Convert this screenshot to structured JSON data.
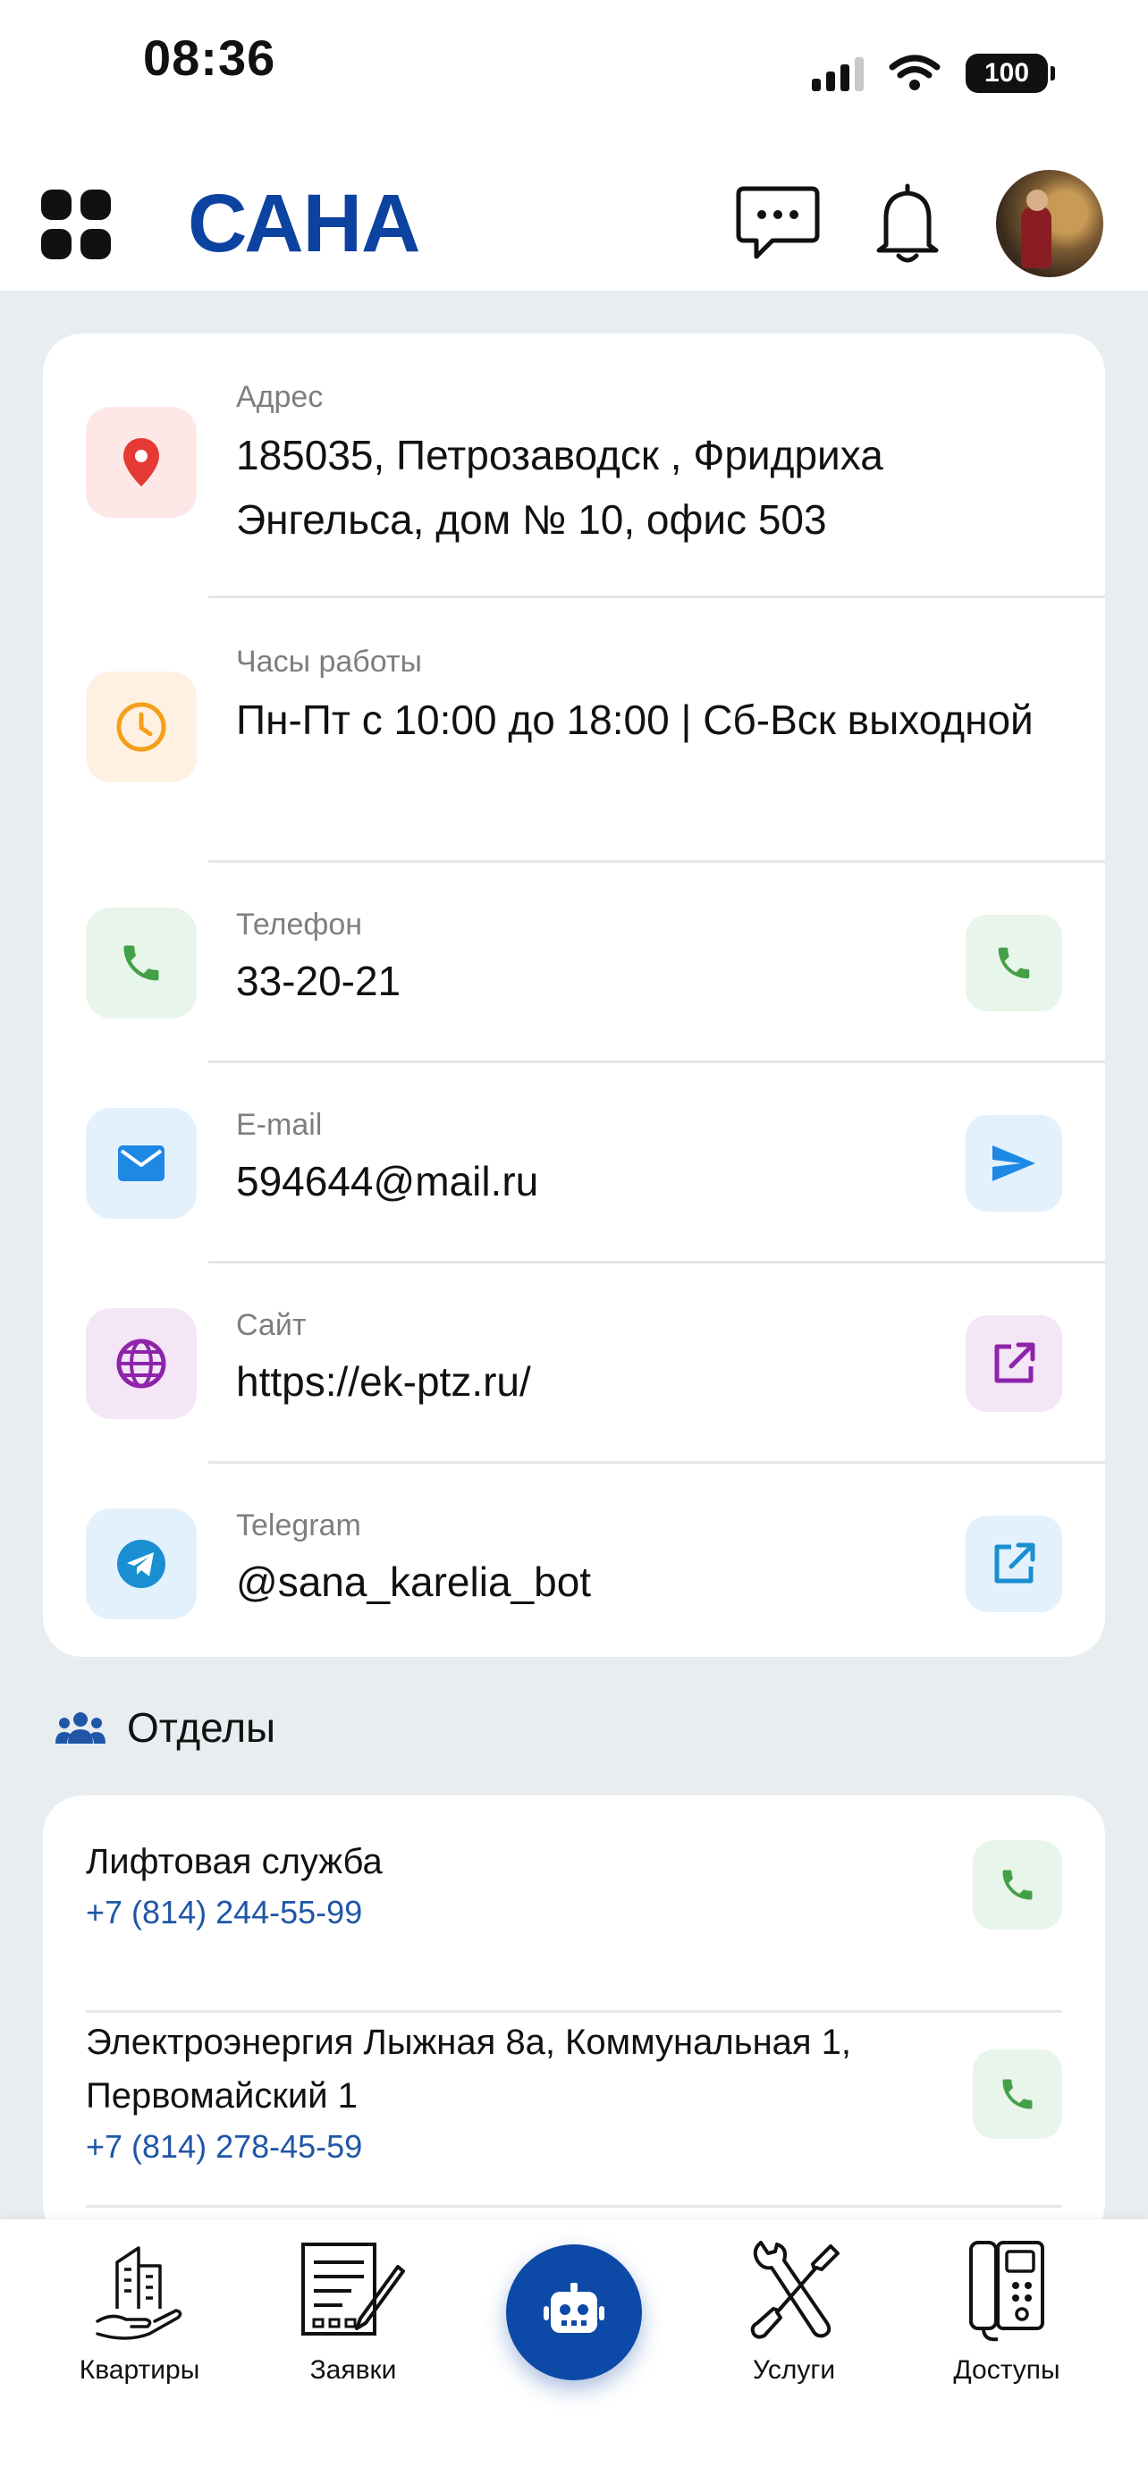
{
  "status_bar": {
    "time": "08:36",
    "battery": "100"
  },
  "header": {
    "logo": "САНА"
  },
  "contacts": [
    {
      "label": "Адрес",
      "value": "185035, Петрозаводск , Фридриха Энгельса, дом № 10, офис 503",
      "icon": "location-pin-icon",
      "color": "#e53935"
    },
    {
      "label": "Часы работы",
      "value": "Пн-Пт с 10:00 до 18:00  | Сб-Вск выходной",
      "icon": "clock-icon",
      "color": "#f59f1a"
    },
    {
      "label": "Телефон",
      "value": "33-20-21",
      "icon": "phone-icon",
      "color": "#43a047"
    },
    {
      "label": "E-mail",
      "value": "594644@mail.ru",
      "icon": "envelope-icon",
      "color": "#1e88e5"
    },
    {
      "label": "Сайт",
      "value": "https://ek-ptz.ru/",
      "icon": "globe-icon",
      "color": "#8e24aa"
    },
    {
      "label": "Telegram",
      "value": "@sana_karelia_bot",
      "icon": "telegram-icon",
      "color": "#1a8fd1"
    }
  ],
  "departments": {
    "title": "Отделы",
    "items": [
      {
        "name": "Лифтовая служба",
        "phone": "+7 (814) 244-55-99"
      },
      {
        "name": "Электроэнергия Лыжная 8а, Коммунальная 1, Первомайский 1",
        "phone": "+7 (814) 278-45-59"
      }
    ]
  },
  "bottom_nav": [
    {
      "label": "Квартиры",
      "icon": "building-hand-icon"
    },
    {
      "label": "Заявки",
      "icon": "form-pen-icon"
    },
    {
      "label": "",
      "icon": "robot-icon"
    },
    {
      "label": "Услуги",
      "icon": "tools-icon"
    },
    {
      "label": "Доступы",
      "icon": "intercom-icon"
    }
  ],
  "colors": {
    "brand": "#0d43a0",
    "link": "#1f56a8",
    "background": "#e8edf0"
  }
}
